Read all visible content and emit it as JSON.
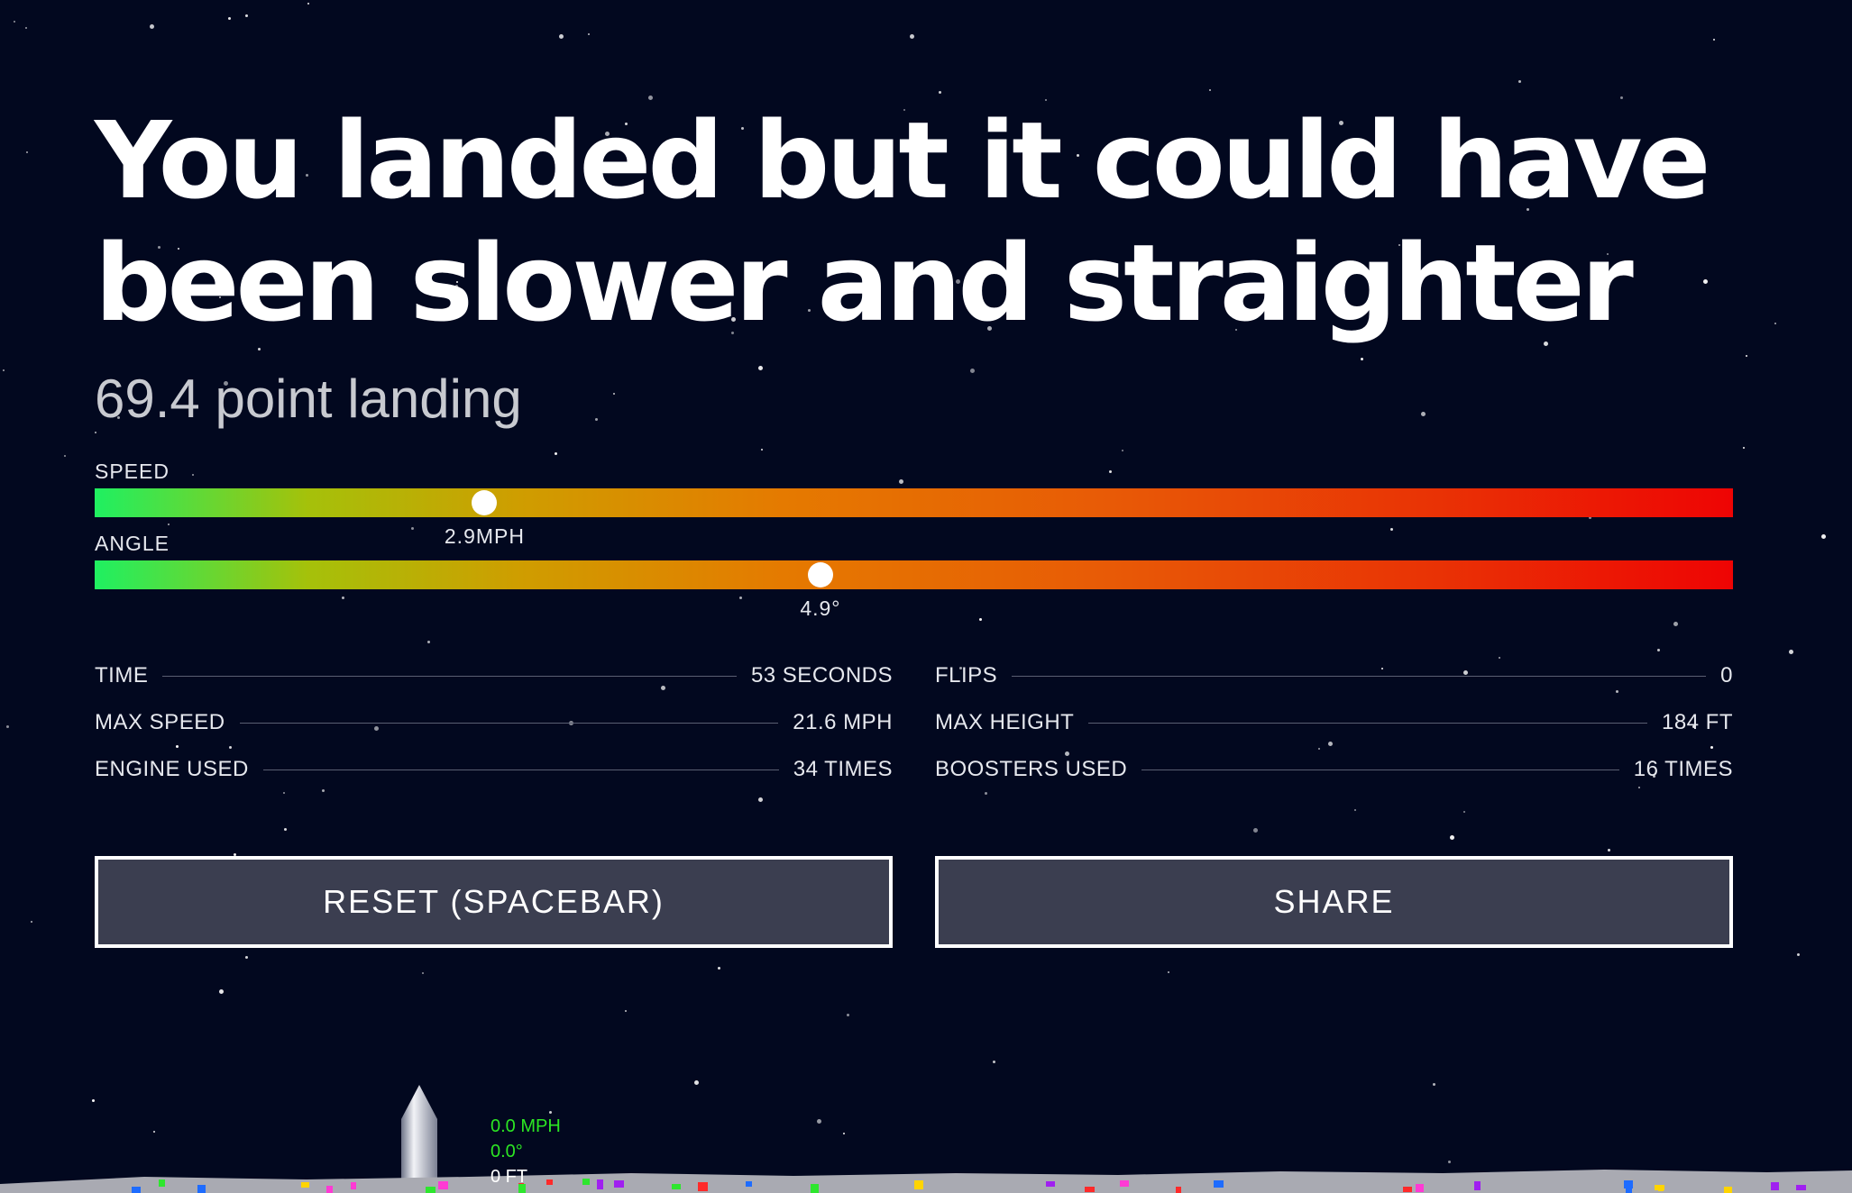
{
  "result": {
    "headline": "You landed but it could have been slower and straighter",
    "score_text": "69.4 point landing"
  },
  "meters": [
    {
      "label": "SPEED",
      "value_text": "2.9MPH",
      "level": 0.238
    },
    {
      "label": "ANGLE",
      "value_text": "4.9°",
      "level": 0.443
    }
  ],
  "stats": {
    "left": [
      {
        "label": "TIME",
        "value": "53 SECONDS"
      },
      {
        "label": "MAX SPEED",
        "value": "21.6 MPH"
      },
      {
        "label": "ENGINE USED",
        "value": "34 TIMES"
      }
    ],
    "right": [
      {
        "label": "FLIPS",
        "value": "0"
      },
      {
        "label": "MAX HEIGHT",
        "value": "184 FT"
      },
      {
        "label": "BOOSTERS USED",
        "value": "16 TIMES"
      }
    ]
  },
  "buttons": {
    "reset_label": "RESET (SPACEBAR)",
    "share_label": "SHARE"
  },
  "hud": {
    "speed": "0.0 MPH",
    "angle": "0.0°",
    "height": "0 FT"
  },
  "colors": {
    "background": "#02081f",
    "button_bg": "#3b3e50",
    "meter_start": "#1ff061",
    "meter_end": "#ee0404",
    "hud_green": "#2ce623"
  }
}
